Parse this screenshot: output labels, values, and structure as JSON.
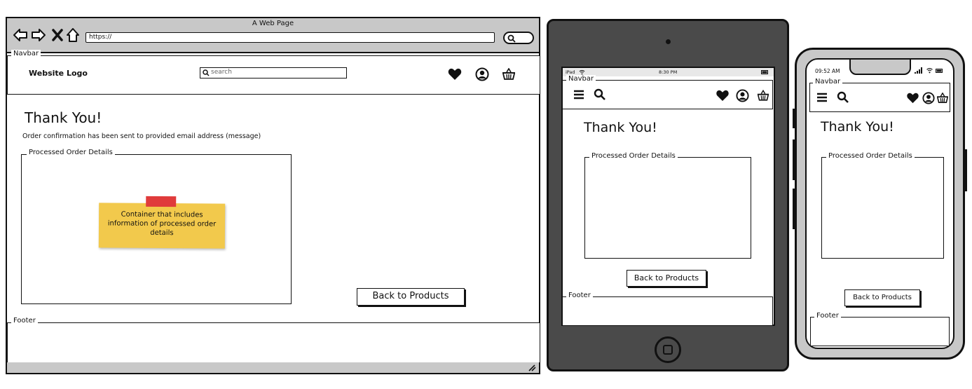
{
  "desktop": {
    "window_title": "A Web Page",
    "url": "https://",
    "navbar_label": "Navbar",
    "logo": "Website Logo",
    "search_placeholder": "search",
    "thank_you": "Thank You!",
    "confirmation_message": "Order confirmation has been sent to provided email address (message)",
    "details_label": "Processed Order Details",
    "note": "Container that includes information of processed order details",
    "back_button": "Back to Products",
    "footer_label": "Footer"
  },
  "tablet": {
    "status_device": "iPad",
    "status_time": "8:30 PM",
    "navbar_label": "Navbar",
    "thank_you": "Thank You!",
    "details_label": "Processed Order Details",
    "back_button": "Back to Products",
    "footer_label": "Footer"
  },
  "phone": {
    "status_time": "09:52 AM",
    "navbar_label": "Navbar",
    "thank_you": "Thank You!",
    "details_label": "Processed Order Details",
    "back_button": "Back to Products",
    "footer_label": "Footer"
  },
  "colors": {
    "chrome_gray": "#c8c8c8",
    "device_dark": "#4a4a4a",
    "sticky_yellow": "#f2c94c",
    "tape_red": "#e03b3b"
  },
  "icons": [
    "back-arrow-icon",
    "forward-arrow-icon",
    "close-icon",
    "home-icon",
    "search-icon",
    "heart-icon",
    "user-icon",
    "basket-icon",
    "hamburger-icon",
    "wifi-icon",
    "battery-icon",
    "signal-icon"
  ]
}
